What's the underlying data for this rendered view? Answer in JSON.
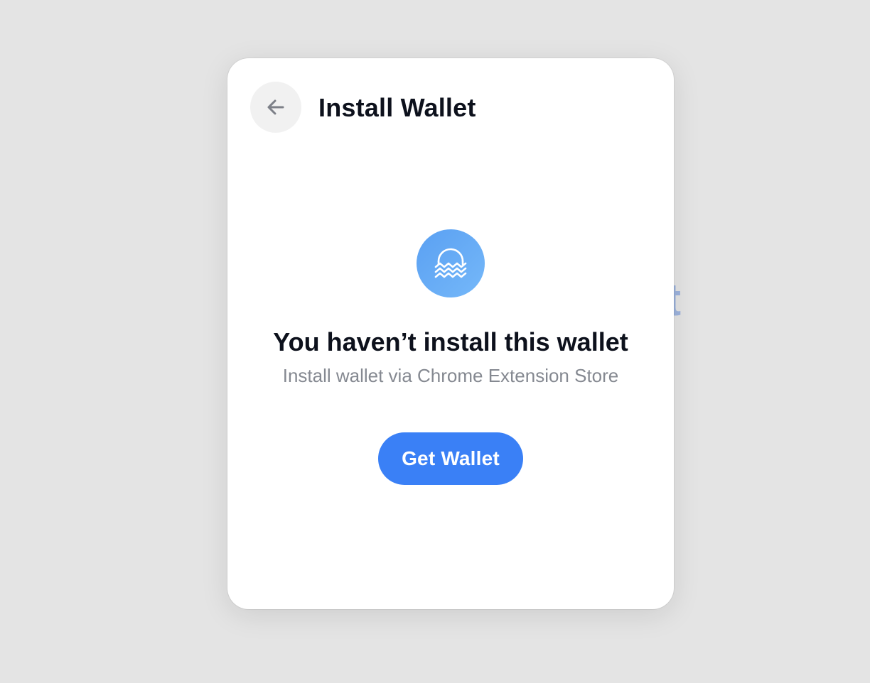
{
  "background": {
    "partial_text": "it"
  },
  "modal": {
    "title": "Install Wallet",
    "back_icon": "arrow-left-icon",
    "wallet_icon": "wave-wallet-icon",
    "heading": "You haven’t install this wallet",
    "subtext": "Install wallet via Chrome Extension Store",
    "button_label": "Get Wallet"
  },
  "colors": {
    "page_bg": "#e4e4e4",
    "card_bg": "#ffffff",
    "accent": "#3a80f6",
    "icon_gradient_start": "#5aa0f2",
    "icon_gradient_end": "#75b8f9",
    "title_text": "#0d111c",
    "secondary_text": "#858991",
    "back_button_bg": "#f1f1f1"
  }
}
